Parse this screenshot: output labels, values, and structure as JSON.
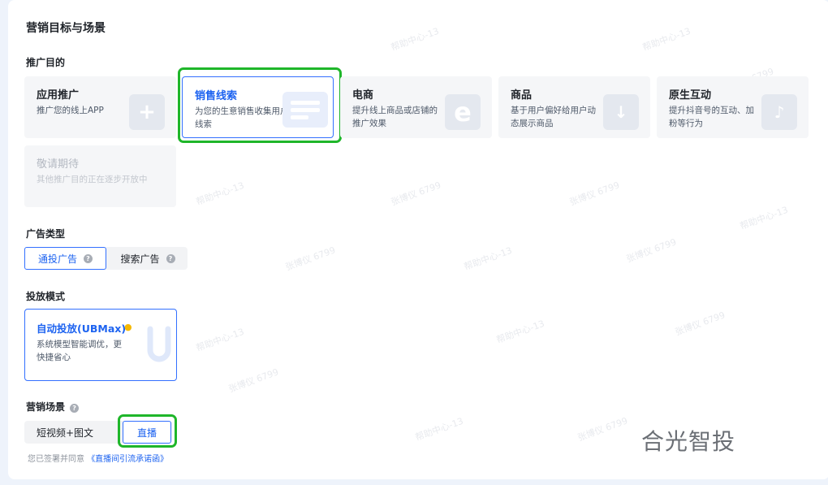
{
  "page": {
    "title": "营销目标与场景"
  },
  "purpose": {
    "label": "推广目的",
    "cards": [
      {
        "title": "应用推广",
        "desc": "推广您的线上APP",
        "icon": "plus-icon"
      },
      {
        "title": "销售线索",
        "desc": "为您的生意销售收集用户线索",
        "icon": "form-icon",
        "selected": true
      },
      {
        "title": "电商",
        "desc": "提升线上商品或店铺的推广效果",
        "icon": "ecommerce-icon"
      },
      {
        "title": "商品",
        "desc": "基于用户偏好给用户动态展示商品",
        "icon": "cart-icon"
      },
      {
        "title": "原生互动",
        "desc": "提升抖音号的互动、加粉等行为",
        "icon": "douyin-icon"
      }
    ],
    "coming_soon": {
      "title": "敬请期待",
      "desc": "其他推广目的正在逐步开放中"
    }
  },
  "ad_type": {
    "label": "广告类型",
    "options": [
      {
        "label": "通投广告",
        "selected": true
      },
      {
        "label": "搜索广告",
        "selected": false
      }
    ]
  },
  "delivery": {
    "label": "投放模式",
    "card": {
      "title": "自动投放(UBMax)",
      "desc": "系统模型智能调优，更快捷省心"
    }
  },
  "scene": {
    "label": "营销场景",
    "options": [
      {
        "label": "短视频+图文",
        "selected": false
      },
      {
        "label": "直播",
        "selected": true
      }
    ],
    "agreement_prefix": "您已签署并同意",
    "agreement_link": "《直播间引流承诺函》"
  },
  "brand_watermark": "合光智投",
  "watermarks": [
    "帮助中心-13",
    "张博仪 6799"
  ],
  "colors": {
    "accent": "#3370ff",
    "highlight": "#1fb62a"
  }
}
